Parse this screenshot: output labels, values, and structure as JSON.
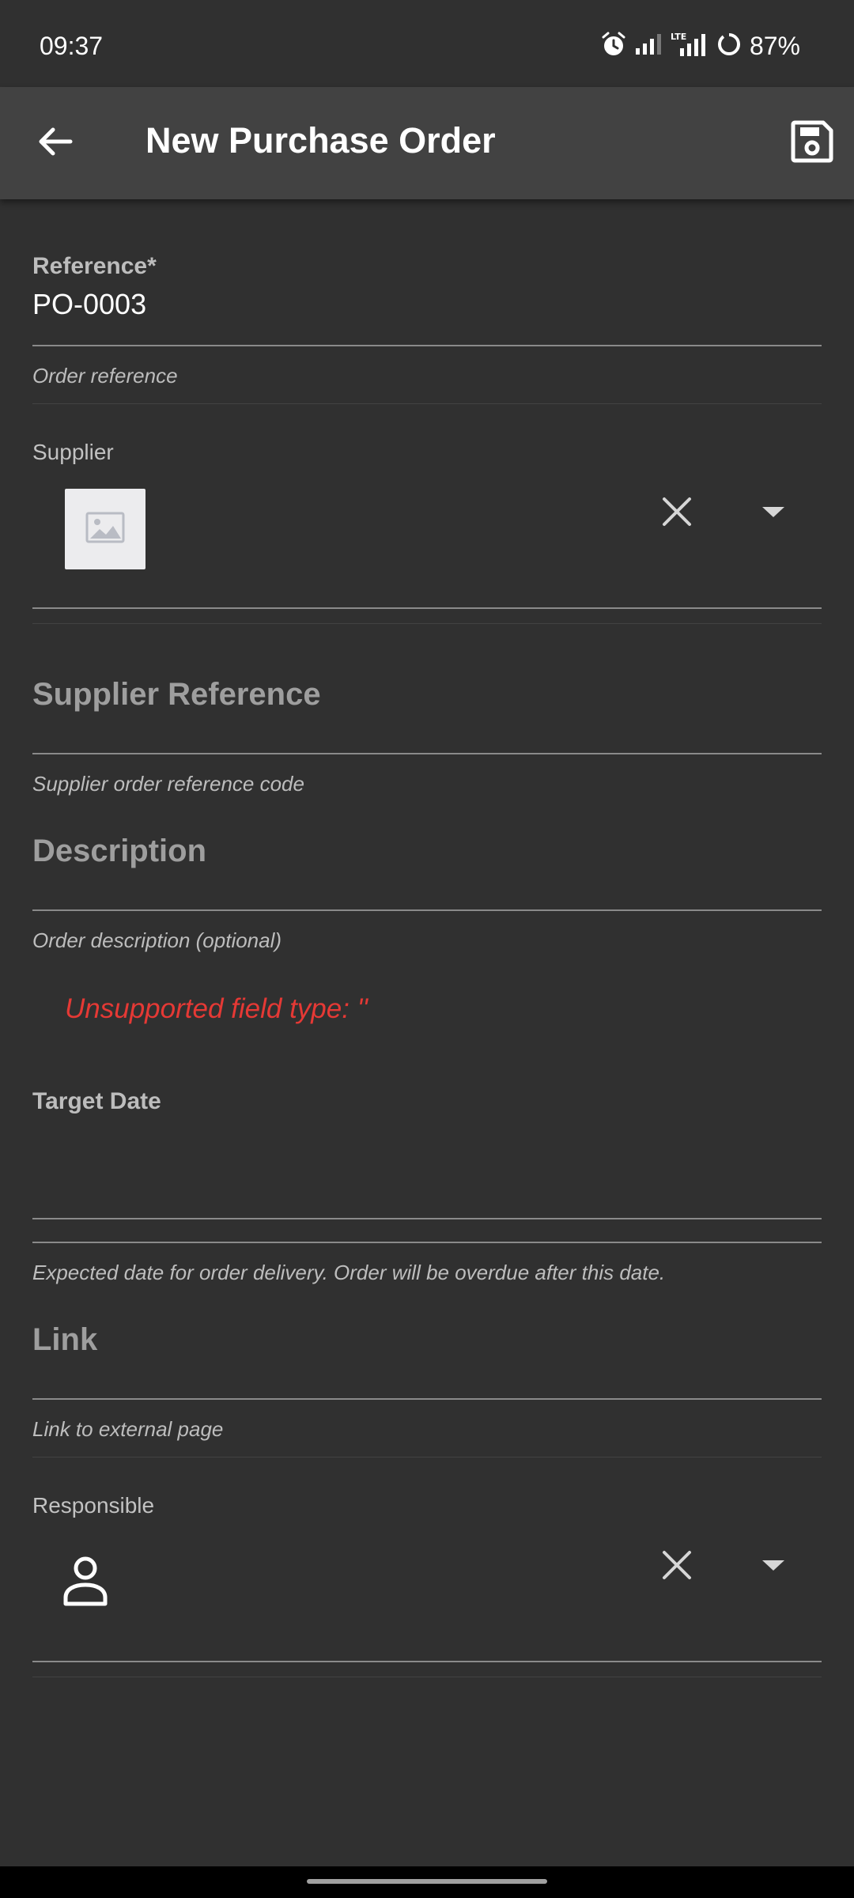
{
  "status_bar": {
    "time": "09:37",
    "battery_percent": "87%",
    "icons": [
      "alarm-icon",
      "signal-icon",
      "lte-signal-icon",
      "battery-ring-icon"
    ]
  },
  "app_bar": {
    "title": "New Purchase Order",
    "back_icon": "arrow-left-icon",
    "save_icon": "save-icon"
  },
  "form": {
    "reference": {
      "label": "Reference*",
      "value": "PO-0003",
      "helper": "Order reference"
    },
    "supplier": {
      "label": "Supplier",
      "image_icon": "image-placeholder-icon",
      "clear_icon": "close-icon",
      "dropdown_icon": "dropdown-arrow-icon"
    },
    "supplier_reference": {
      "placeholder": "Supplier Reference",
      "helper": "Supplier order reference code"
    },
    "description": {
      "placeholder": "Description",
      "helper": "Order description (optional)"
    },
    "unsupported": {
      "text": "Unsupported field type: ''"
    },
    "target_date": {
      "label": "Target Date",
      "helper": "Expected date for order delivery. Order will be overdue after this date."
    },
    "link": {
      "placeholder": "Link",
      "helper": "Link to external page"
    },
    "responsible": {
      "label": "Responsible",
      "person_icon": "person-icon",
      "clear_icon": "close-icon",
      "dropdown_icon": "dropdown-arrow-icon"
    }
  },
  "colors": {
    "background": "#303030",
    "app_bar": "#424242",
    "error": "#e53935"
  }
}
